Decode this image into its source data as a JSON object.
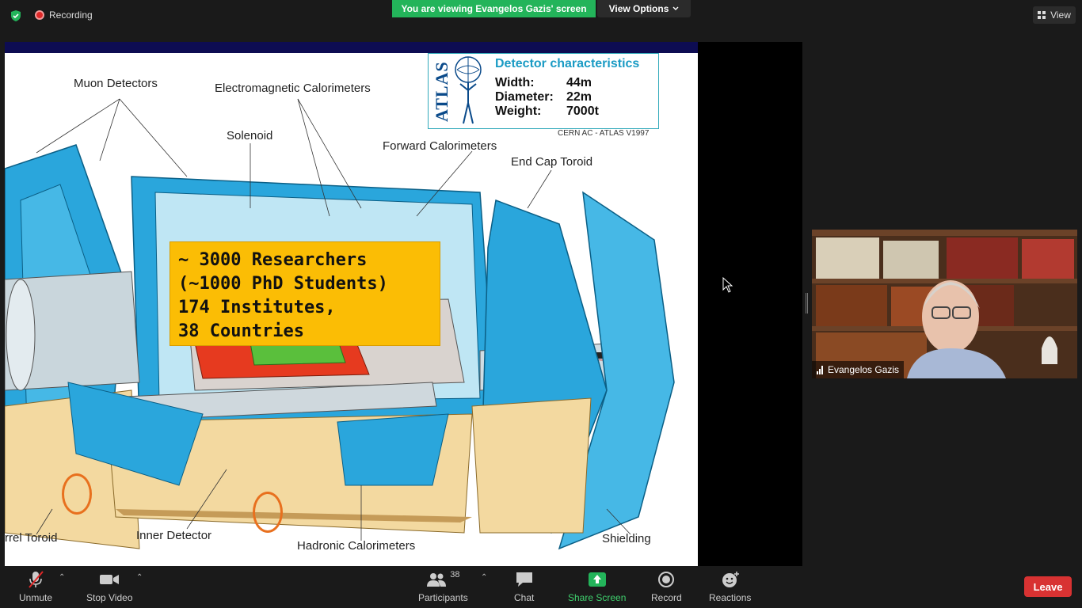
{
  "topbar": {
    "recording_label": "Recording",
    "viewing_banner": "You are viewing Evangelos Gazis' screen",
    "view_options_label": "View Options",
    "view_label": "View"
  },
  "slide": {
    "labels": {
      "muon": "Muon Detectors",
      "em_cal": "Electromagnetic Calorimeters",
      "solenoid": "Solenoid",
      "forward_cal": "Forward Calorimeters",
      "endcap": "End Cap Toroid",
      "barrel": "rrel Toroid",
      "inner": "Inner Detector",
      "hadronic": "Hadronic Calorimeters",
      "shielding": "Shielding"
    },
    "info": {
      "logo": "ATLAS",
      "title": "Detector characteristics",
      "rows": [
        {
          "k": "Width:",
          "v": "44m"
        },
        {
          "k": "Diameter:",
          "v": "22m"
        },
        {
          "k": "Weight:",
          "v": "7000t"
        }
      ],
      "credit": "CERN AC - ATLAS V1997"
    },
    "highlight": {
      "line1": "~ 3000 Researchers",
      "line2": "(~1000 PhD Students)",
      "line3": "174 Institutes,",
      "line4": "38 Countries"
    }
  },
  "video": {
    "participant_name": "Evangelos Gazis"
  },
  "toolbar": {
    "unmute": "Unmute",
    "stop_video": "Stop Video",
    "participants": "Participants",
    "participant_count": "38",
    "chat": "Chat",
    "share_screen": "Share Screen",
    "record": "Record",
    "reactions": "Reactions",
    "leave": "Leave"
  },
  "colors": {
    "green_banner": "#23b45a",
    "leave_red": "#d83232",
    "detector_blue": "#2aa6dc",
    "highlight_yellow": "#fbbd05"
  }
}
